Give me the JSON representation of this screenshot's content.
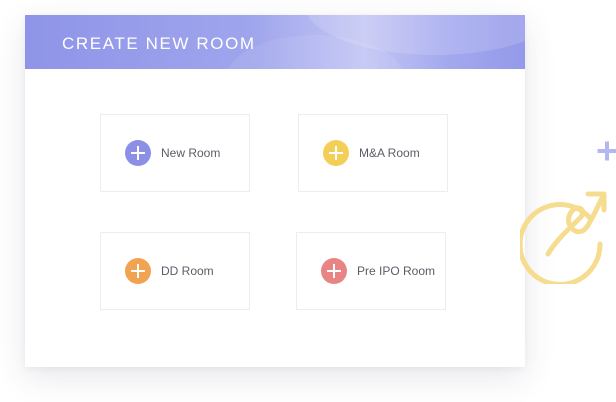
{
  "header": {
    "title": "CREATE NEW ROOM"
  },
  "rooms": [
    {
      "label": "New Room",
      "color": "#8c8fe6"
    },
    {
      "label": "M&A Room",
      "color": "#f3cf58"
    },
    {
      "label": "DD Room",
      "color": "#f1a352"
    },
    {
      "label": "Pre IPO Room",
      "color": "#e98484"
    }
  ],
  "decor": {
    "plus_color": "#b4b8f0",
    "loop_arrow_color": "#f6dc8e"
  }
}
